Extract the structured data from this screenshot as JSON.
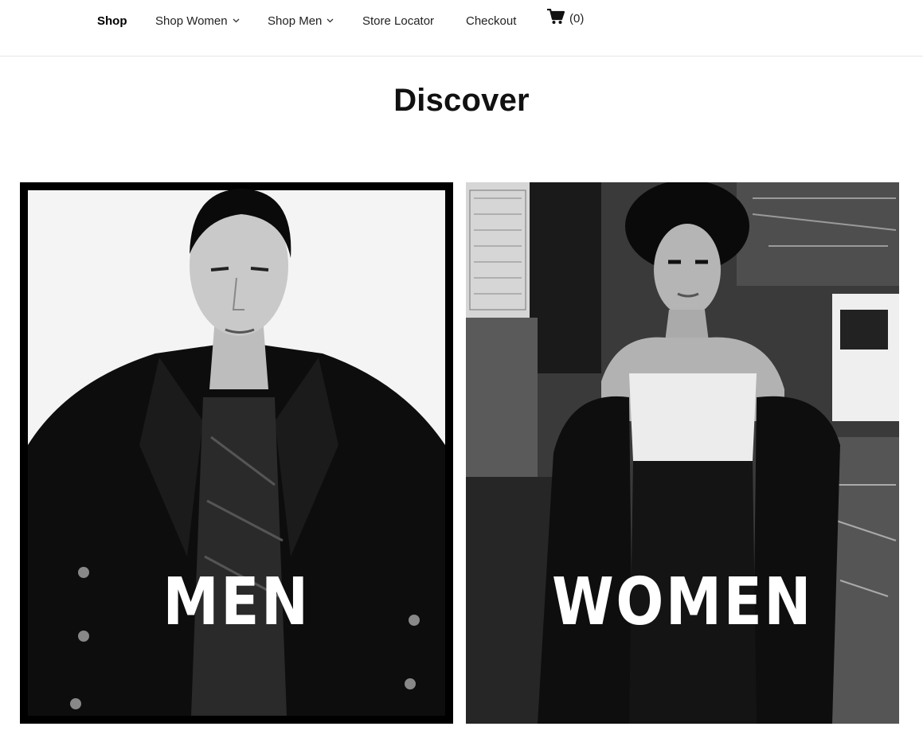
{
  "nav": {
    "items": [
      {
        "label": "Shop",
        "active": true,
        "dropdown": false
      },
      {
        "label": "Shop Women",
        "active": false,
        "dropdown": true
      },
      {
        "label": "Shop Men",
        "active": false,
        "dropdown": true
      },
      {
        "label": "Store Locator",
        "active": false,
        "dropdown": false
      },
      {
        "label": "Checkout",
        "active": false,
        "dropdown": false
      }
    ],
    "cart": {
      "icon": "shopping-cart-icon",
      "count": "(0)"
    }
  },
  "page": {
    "title": "Discover"
  },
  "tiles": [
    {
      "label": "MEN",
      "photo": "man-in-black-coat-photo"
    },
    {
      "label": "WOMEN",
      "photo": "woman-in-hat-photo"
    }
  ],
  "colors": {
    "text": "#222222",
    "border": "#e6e6e6",
    "tile_label": "#ffffff"
  }
}
